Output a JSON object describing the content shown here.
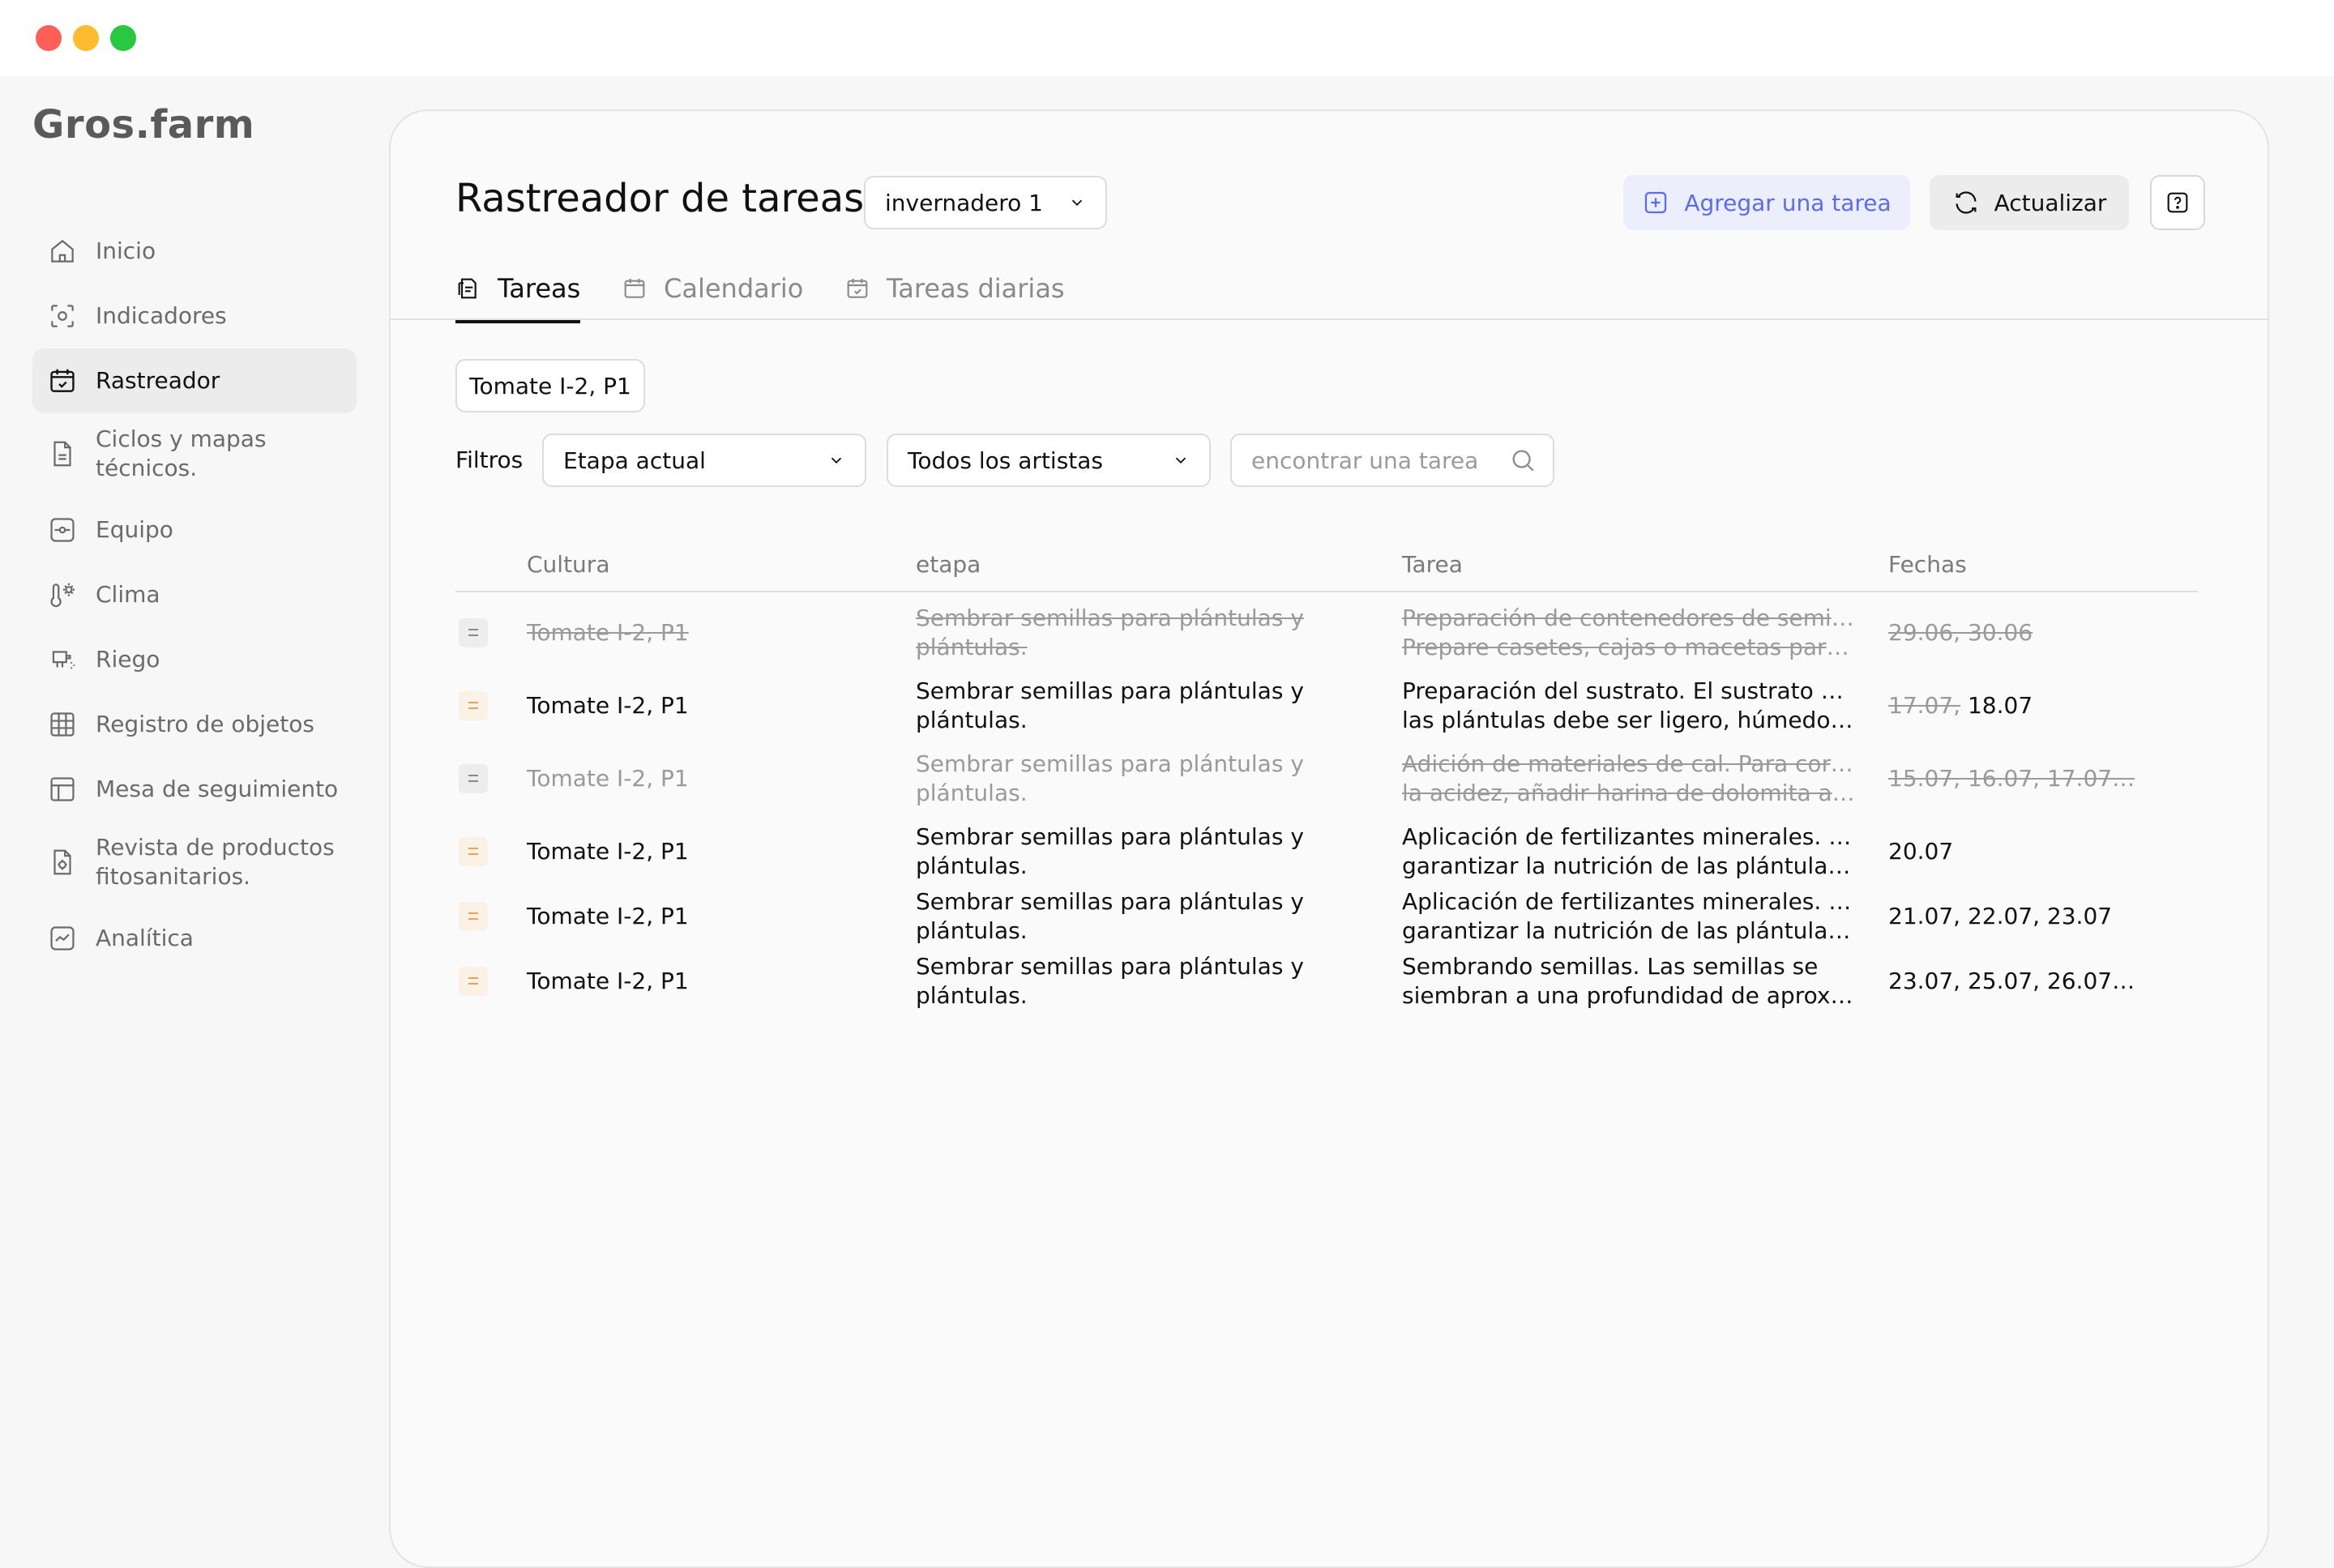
{
  "window": {
    "controls": [
      "close",
      "minimize",
      "maximize"
    ]
  },
  "app": {
    "logo": "Gros.farm"
  },
  "sidebar": {
    "items": [
      {
        "label": "Inicio",
        "icon": "home-icon",
        "active": false
      },
      {
        "label": "Indicadores",
        "icon": "indicators-icon",
        "active": false
      },
      {
        "label": "Rastreador",
        "icon": "tracker-icon",
        "active": true
      },
      {
        "label": "Ciclos y mapas técnicos.",
        "icon": "document-icon",
        "active": false
      },
      {
        "label": "Equipo",
        "icon": "equipment-icon",
        "active": false
      },
      {
        "label": "Clima",
        "icon": "climate-icon",
        "active": false
      },
      {
        "label": "Riego",
        "icon": "irrigation-icon",
        "active": false
      },
      {
        "label": "Registro de objetos",
        "icon": "grid-icon",
        "active": false
      },
      {
        "label": "Mesa de seguimiento",
        "icon": "table-icon",
        "active": false
      },
      {
        "label": "Revista de productos fitosanitarios.",
        "icon": "pesticide-doc-icon",
        "active": false
      },
      {
        "label": "Analítica",
        "icon": "analytics-icon",
        "active": false
      }
    ]
  },
  "header": {
    "title": "Rastreador de tareas",
    "greenhouse_select": "invernadero 1",
    "add_task": "Agregar una tarea",
    "refresh": "Actualizar",
    "help": "?"
  },
  "tabs": [
    {
      "label": "Tareas",
      "active": true
    },
    {
      "label": "Calendario",
      "active": false
    },
    {
      "label": "Tareas diarias",
      "active": false
    }
  ],
  "chip": "Tomate I-2, P1",
  "filters": {
    "label": "Filtros",
    "stage": "Etapa actual",
    "artists": "Todos los artistas",
    "search_placeholder": "encontrar una tarea"
  },
  "table": {
    "columns": [
      "Cultura",
      "etapa",
      "Tarea",
      "Fechas"
    ],
    "rows": [
      {
        "status": "done",
        "crop": "Tomate I-2, P1",
        "stage": [
          "Sembrar semillas para plántulas y",
          "plántulas."
        ],
        "task": [
          "Preparación de contenedores de semillas.",
          "Prepare casetes, cajas o macetas para s…"
        ],
        "dates_old": "29.06, 30.06",
        "dates": ""
      },
      {
        "status": "pending",
        "crop": "Tomate I-2, P1",
        "stage": [
          "Sembrar semillas para plántulas y",
          "plántulas."
        ],
        "task": [
          "Preparación del sustrato. El sustrato para",
          "las plántulas debe ser ligero, húmedo y t…"
        ],
        "dates_old": "17.07,",
        "dates": "18.07"
      },
      {
        "status": "done",
        "crop": "Tomate I-2, P1",
        "stage": [
          "Sembrar semillas para plántulas y",
          "plántulas."
        ],
        "task": [
          "Adición de materiales de cal. Para corregir",
          "la acidez, añadir harina de dolomita a ra…"
        ],
        "dates_old": "15.07, 16.07, 17.07…",
        "dates": ""
      },
      {
        "status": "pending",
        "crop": "Tomate I-2, P1",
        "stage": [
          "Sembrar semillas para plántulas y",
          "plántulas."
        ],
        "task": [
          "Aplicación de fertilizantes minerales. Para",
          "garantizar la nutrición de las plántulas e…"
        ],
        "dates_old": "",
        "dates": "20.07"
      },
      {
        "status": "pending",
        "crop": "Tomate I-2, P1",
        "stage": [
          "Sembrar semillas para plántulas y",
          "plántulas."
        ],
        "task": [
          "Aplicación de fertilizantes minerales. Para",
          "garantizar la nutrición de las plántulas e…"
        ],
        "dates_old": "",
        "dates": "21.07, 22.07, 23.07"
      },
      {
        "status": "pending",
        "crop": "Tomate I-2, P1",
        "stage": [
          "Sembrar semillas para plántulas y",
          "plántulas."
        ],
        "task": [
          "Sembrando semillas. Las semillas se",
          "siembran a una profundidad de aproxim…"
        ],
        "dates_old": "",
        "dates": "23.07, 25.07, 26.07…"
      }
    ]
  },
  "colors": {
    "accent": "#5a6cf0",
    "accent_bg": "#eceefb",
    "pending_handle": "#e8a25a",
    "done_text": "#9a9a9a"
  }
}
